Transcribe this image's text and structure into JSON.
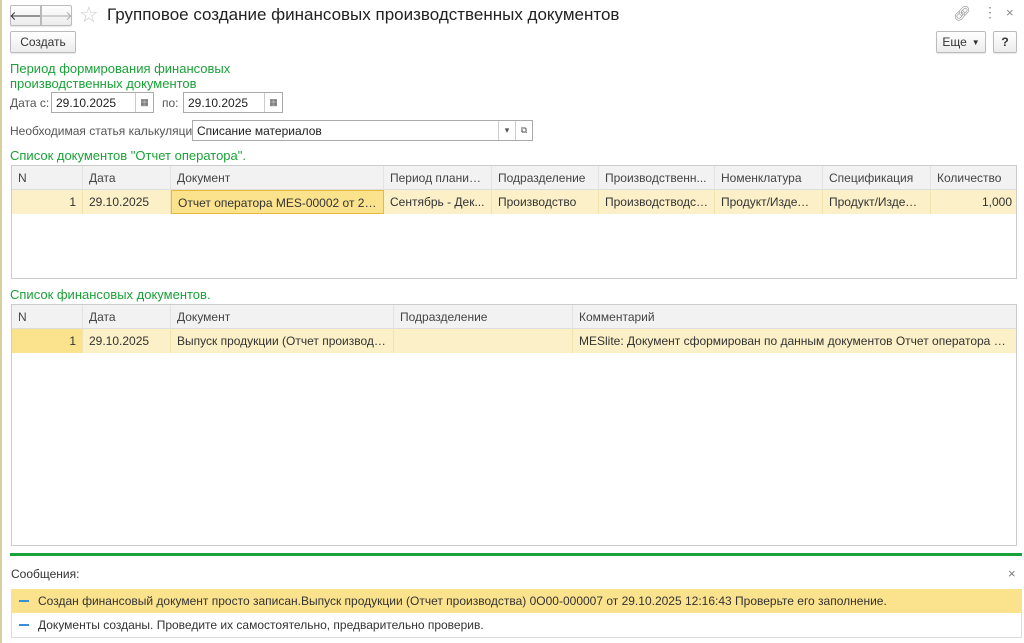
{
  "window": {
    "title": "Групповое создание финансовых производственных документов"
  },
  "toolbar": {
    "create_label": "Создать",
    "more_label": "Еще",
    "help_label": "?"
  },
  "period": {
    "title": "Период формирования финансовых производственных документов",
    "from_label": "Дата с:",
    "from_value": "29.10.2025",
    "to_label": "по:",
    "to_value": "29.10.2025"
  },
  "calc": {
    "label": "Необходимая статья калькуляции:",
    "value": "Списание материалов"
  },
  "operator_list": {
    "title": "Список документов \"Отчет оператора\".",
    "columns": [
      "N",
      "Дата",
      "Документ",
      "Период планир...",
      "Подразделение",
      "Производственн...",
      "Номенклатура",
      "Спецификация",
      "Количество"
    ],
    "rows": [
      [
        "1",
        "29.10.2025",
        "Отчет оператора MES-00002 от 29....",
        "Сентябрь - Дек...",
        "Производство",
        "Производстводст...",
        "Продукт/Издели...",
        "Продукт/Издели...",
        "1,000"
      ]
    ]
  },
  "finance_list": {
    "title": "Список финансовых документов.",
    "columns": [
      "N",
      "Дата",
      "Документ",
      "Подразделение",
      "Комментарий"
    ],
    "rows": [
      [
        "1",
        "29.10.2025",
        "Выпуск продукции (Отчет производст...",
        "",
        "MESlite: Документ сформирован по данным документов Отчет оператора по по..."
      ]
    ]
  },
  "messages": {
    "title": "Сообщения:",
    "close": "×",
    "items": [
      "Создан финансовый документ просто записан.Выпуск продукции (Отчет производства) 0О00-000007 от 29.10.2025 12:16:43 Проверьте его заполнение.",
      "Документы созданы. Проведите их самостоятельно, предварительно проверив."
    ]
  },
  "colors": {
    "accent_green": "#1aa137",
    "highlight": "#fbe38e",
    "row_bg": "#fbf0c7"
  }
}
